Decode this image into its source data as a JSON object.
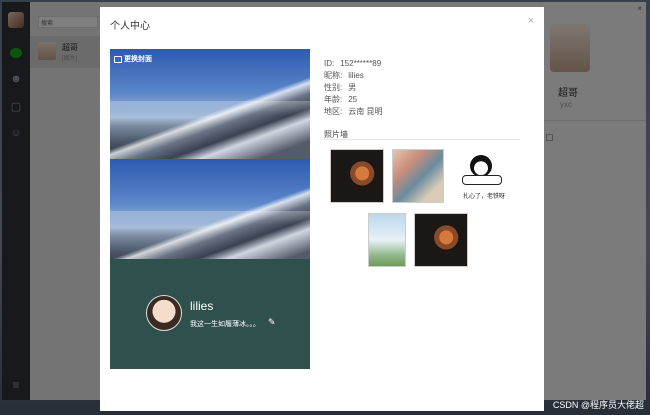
{
  "app": {
    "search_placeholder": "搜索",
    "chat_item": {
      "name": "超哥",
      "preview": "[图片]"
    },
    "right_panel": {
      "name": "超哥",
      "sub": "yxc",
      "close": "×"
    },
    "menu_icon": "menu-icon"
  },
  "modal": {
    "title": "个人中心",
    "close": "×",
    "cover": {
      "change_cover_label": "更换封面",
      "nickname": "lilies",
      "signature": "我这一生如履薄冰。。。",
      "edit_icon": "✎"
    },
    "info": [
      {
        "label": "ID:",
        "value": "152******89"
      },
      {
        "label": "昵称:",
        "value": "lilies"
      },
      {
        "label": "性别:",
        "value": "男"
      },
      {
        "label": "年龄:",
        "value": "25"
      },
      {
        "label": "地区:",
        "value": "云南 昆明"
      }
    ],
    "photo_wall": {
      "title": "照片墙",
      "meme_caption": "扎心了，老铁呀"
    }
  },
  "watermark": "CSDN @程序员大佬超"
}
